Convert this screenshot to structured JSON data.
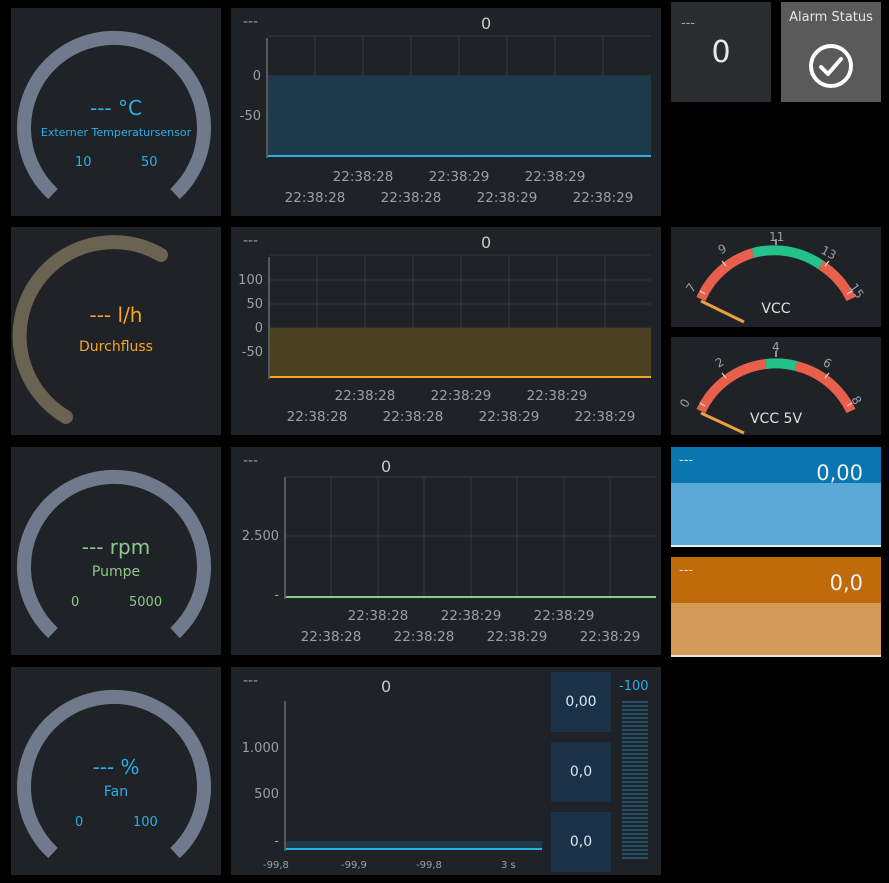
{
  "gauges": [
    {
      "value": "---",
      "unit": "°C",
      "label": "Externer Temperatursensor",
      "min": "10",
      "max": "50",
      "color": "#2ab0e8",
      "track": "#6f7b8c"
    },
    {
      "value": "---",
      "unit": "l/h",
      "label": "Durchfluss",
      "min": "",
      "max": "",
      "color": "#f5a623",
      "track": "#6b6352"
    },
    {
      "value": "---",
      "unit": "rpm",
      "label": "Pumpe",
      "min": "0",
      "max": "5000",
      "color": "#8fc98a",
      "track": "#6f7b8c"
    },
    {
      "value": "---",
      "unit": "%",
      "label": "Fan",
      "min": "0",
      "max": "100",
      "color": "#2ab0e8",
      "track": "#6f7b8c"
    }
  ],
  "charts": [
    {
      "title": "---",
      "value": "0",
      "yticks": [
        "0",
        "-50"
      ],
      "times_top": [
        "22:38:28",
        "22:38:29",
        "22:38:29"
      ],
      "times_bottom": [
        "22:38:28",
        "22:38:28",
        "22:38:29",
        "22:38:29"
      ],
      "color": "#2ab0e8"
    },
    {
      "title": "---",
      "value": "0",
      "yticks": [
        "100",
        "50",
        "0",
        "-50"
      ],
      "times_top": [
        "22:38:28",
        "22:38:29",
        "22:38:29"
      ],
      "times_bottom": [
        "22:38:28",
        "22:38:28",
        "22:38:29",
        "22:38:29"
      ],
      "color": "#f5a623"
    },
    {
      "title": "---",
      "value": "0",
      "yticks": [
        "2.500",
        "-"
      ],
      "times_top": [
        "22:38:28",
        "22:38:29",
        "22:38:29"
      ],
      "times_bottom": [
        "22:38:28",
        "22:38:28",
        "22:38:29",
        "22:38:29"
      ],
      "color": "#8fc98a"
    },
    {
      "title": "---",
      "value": "0",
      "yticks": [
        "1.000",
        "500",
        "-"
      ],
      "bottom_labels": [
        "-99,8",
        "-99,9",
        "-99,8",
        "3 s"
      ],
      "color": "#2ab0e8"
    }
  ],
  "tiles": {
    "counter": {
      "title": "---",
      "value": "0"
    },
    "alarm": {
      "title": "Alarm Status"
    }
  },
  "arc_gauges": [
    {
      "label": "VCC",
      "ticks": [
        "7",
        "9",
        "11",
        "13",
        "15"
      ]
    },
    {
      "label": "VCC 5V",
      "ticks": [
        "0",
        "2",
        "4",
        "6",
        "8"
      ]
    }
  ],
  "levels": [
    {
      "title": "---",
      "value": "0,00",
      "top_color": "#0a76b0",
      "fill_color": "#5aa8d6"
    },
    {
      "title": "---",
      "value": "0,0",
      "top_color": "#c06a0a",
      "fill_color": "#d49a58"
    }
  ],
  "mini_values": [
    "0,00",
    "0,0",
    "0,0"
  ],
  "bar_meter": {
    "label": "-100"
  }
}
